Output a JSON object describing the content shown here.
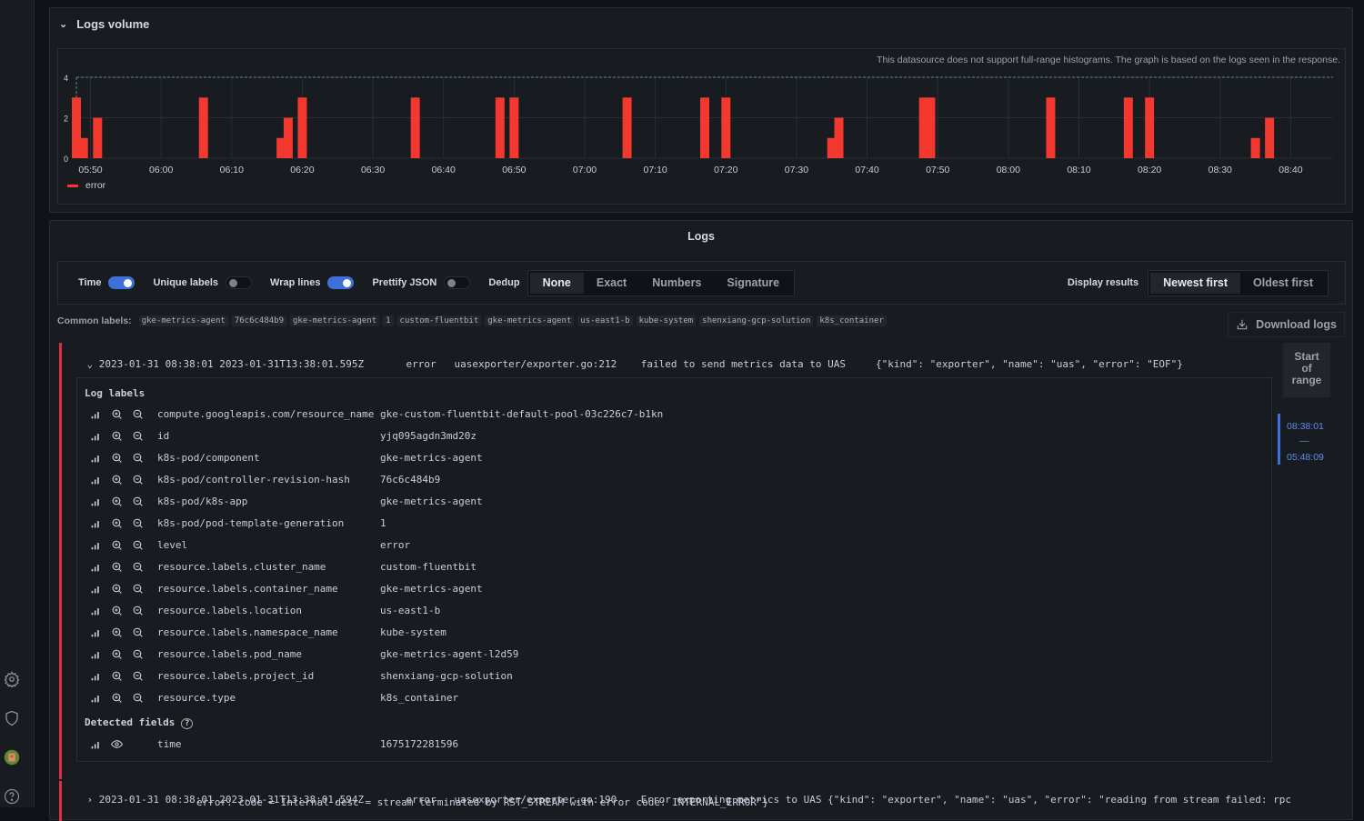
{
  "sidebar": {
    "icons": [
      "gear-icon",
      "shield-icon",
      "avatar",
      "help-icon"
    ]
  },
  "logs_volume": {
    "title": "Logs volume",
    "note": "This datasource does not support full-range histograms. The graph is based on the logs seen in the response."
  },
  "chart_data": {
    "type": "bar",
    "title": "Logs volume",
    "xlabel": "",
    "ylabel": "",
    "x_tick_labels": [
      "05:50",
      "06:00",
      "06:10",
      "06:20",
      "06:30",
      "06:40",
      "06:50",
      "07:00",
      "07:10",
      "07:20",
      "07:30",
      "07:40",
      "07:50",
      "08:00",
      "08:10",
      "08:20",
      "08:30",
      "08:40"
    ],
    "y_tick_labels": [
      "0",
      "2",
      "4"
    ],
    "xlim": [
      "05:48",
      "08:46"
    ],
    "ylim": [
      0,
      4
    ],
    "grid": true,
    "legend": "bottom-left",
    "series": [
      {
        "name": "error",
        "color": "#f2382f",
        "x": [
          "05:48",
          "05:49",
          "05:51",
          "06:06",
          "06:17",
          "06:18",
          "06:20",
          "06:36",
          "06:48",
          "06:50",
          "07:06",
          "07:17",
          "07:20",
          "07:35",
          "07:36",
          "07:48",
          "07:49",
          "08:06",
          "08:17",
          "08:20",
          "08:35",
          "08:37"
        ],
        "values": [
          3,
          1,
          2,
          3,
          1,
          2,
          3,
          3,
          3,
          3,
          3,
          3,
          3,
          1,
          2,
          3,
          3,
          3,
          3,
          3,
          1,
          2
        ]
      }
    ]
  },
  "logs": {
    "title": "Logs",
    "controls": {
      "time": {
        "label": "Time",
        "on": true
      },
      "unique_labels": {
        "label": "Unique labels",
        "on": false
      },
      "wrap_lines": {
        "label": "Wrap lines",
        "on": true
      },
      "prettify_json": {
        "label": "Prettify JSON",
        "on": false
      },
      "dedup": {
        "label": "Dedup",
        "options": [
          "None",
          "Exact",
          "Numbers",
          "Signature"
        ],
        "selected": "None"
      },
      "display_results": {
        "label": "Display results",
        "options": [
          "Newest first",
          "Oldest first"
        ],
        "selected": "Newest first"
      }
    },
    "common_labels": {
      "label": "Common labels:",
      "values": [
        "gke-metrics-agent",
        "76c6c484b9",
        "gke-metrics-agent",
        "1",
        "custom-fluentbit",
        "gke-metrics-agent",
        "us-east1-b",
        "kube-system",
        "shenxiang-gcp-solution",
        "k8s_container"
      ]
    },
    "download_label": "Download logs",
    "rows": [
      {
        "expanded": true,
        "text": "2023-01-31 08:38:01 2023-01-31T13:38:01.595Z       error   uasexporter/exporter.go:212    failed to send metrics data to UAS     {\"kind\": \"exporter\", \"name\": \"uas\", \"error\": \"EOF\"}"
      },
      {
        "expanded": false,
        "text": "2023-01-31 08:38:01 2023-01-31T13:38:01.594Z       error   uasexporter/exporter.go:190    Error exporting metrics to UAS {\"kind\": \"exporter\", \"name\": \"uas\", \"error\": \"reading from stream failed: rpc",
        "text_cont": "error: code = Internal desc = stream terminated by RST_STREAM with error code: INTERNAL_ERROR\"}"
      }
    ],
    "details": {
      "log_labels_title": "Log labels",
      "labels": [
        {
          "key": "compute.googleapis.com/resource_name",
          "value": "gke-custom-fluentbit-default-pool-03c226c7-b1kn"
        },
        {
          "key": "id",
          "value": "yjq095agdn3md20z"
        },
        {
          "key": "k8s-pod/component",
          "value": "gke-metrics-agent"
        },
        {
          "key": "k8s-pod/controller-revision-hash",
          "value": "76c6c484b9"
        },
        {
          "key": "k8s-pod/k8s-app",
          "value": "gke-metrics-agent"
        },
        {
          "key": "k8s-pod/pod-template-generation",
          "value": "1"
        },
        {
          "key": "level",
          "value": "error"
        },
        {
          "key": "resource.labels.cluster_name",
          "value": "custom-fluentbit"
        },
        {
          "key": "resource.labels.container_name",
          "value": "gke-metrics-agent"
        },
        {
          "key": "resource.labels.location",
          "value": "us-east1-b"
        },
        {
          "key": "resource.labels.namespace_name",
          "value": "kube-system"
        },
        {
          "key": "resource.labels.pod_name",
          "value": "gke-metrics-agent-l2d59"
        },
        {
          "key": "resource.labels.project_id",
          "value": "shenxiang-gcp-solution"
        },
        {
          "key": "resource.type",
          "value": "k8s_container"
        }
      ],
      "detected_fields_title": "Detected fields",
      "fields": [
        {
          "key": "time",
          "value": "1675172281596"
        }
      ]
    },
    "range_nav": {
      "start_label_lines": [
        "Start",
        "of",
        "range"
      ],
      "range_from": "08:38:01",
      "range_sep": "—",
      "range_to": "05:48:09"
    }
  }
}
